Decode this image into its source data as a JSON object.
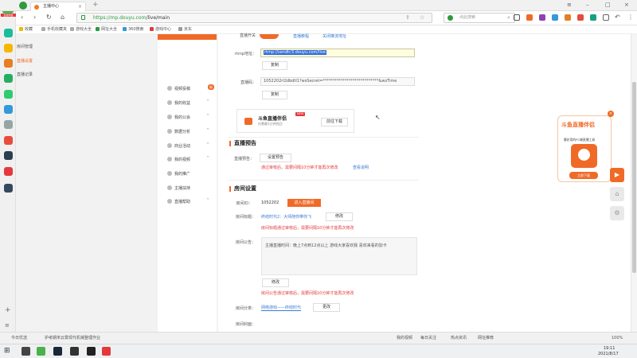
{
  "browser": {
    "tab_title": "主播中心",
    "tab_close": "×",
    "new_tab": "+",
    "url_host": "https://mp.douyu.com",
    "url_path": "/live/main",
    "search_placeholder": "点此搜索",
    "bookmarks": [
      "收藏",
      "手机收藏夹",
      "游戏大全",
      "网址大全",
      "360搜索",
      "游戏中心",
      "京东"
    ]
  },
  "left_bar_label": "百度网盘",
  "sidebar": {
    "sub_items": [
      "房间管理",
      "直播设置",
      "直播记录"
    ],
    "active_index": 1,
    "nav_items": [
      {
        "label": "视频投稿",
        "badge": "新"
      },
      {
        "label": "我的收益"
      },
      {
        "label": "我的公会"
      },
      {
        "label": "数据分析"
      },
      {
        "label": "商业活动"
      },
      {
        "label": "我的视频"
      },
      {
        "label": "我的推广"
      },
      {
        "label": "主播扶持"
      },
      {
        "label": "直播帮助"
      }
    ]
  },
  "top_section": {
    "label": "直播开关",
    "link1": "直播教程",
    "link2": "关闭推流地址"
  },
  "rtmp": {
    "label": "rtmp地址：",
    "value": "rtmp://sendtc3.douyu.com/live",
    "copy": "复制"
  },
  "code": {
    "label": "直播码：",
    "value": "1052202rl2dbdtl1?wsSecret=****************************&wsTime",
    "copy": "复制"
  },
  "promo": {
    "title": "斗鱼直播伴侣",
    "badge": "NEW",
    "subtitle": "仅需最1分钟找回",
    "download": "前往下载"
  },
  "preview": {
    "heading": "直播预告",
    "label": "直播预告：",
    "button": "设置预告",
    "note": "通过审核后，需要间隔10分钟才能再次修改",
    "link": "查看说明"
  },
  "room": {
    "heading": "房间设置",
    "id_label": "房间ID：",
    "id_value": "1052202",
    "enter_button": "进入直播间",
    "title_label": "房间标题：",
    "title_value": "终结时代2：大师随你带你飞",
    "title_edit": "修改",
    "title_note": "房间标题通过审核后，需要间隔10分钟才能再次修改",
    "notice_label": "房间公告：",
    "notice_value": "主播直播时间：晚上7点到12点以上 游戏大家喜欢我 喜欢来看的加卡",
    "notice_edit": "修改",
    "notice_note": "房间公告通过审核后，需要间隔10分钟才能再次修改",
    "category_label": "房间分类：",
    "category_value": "网络游戏——终结时代",
    "category_edit": "更改",
    "thumb_label": "房间封面："
  },
  "float_ad": {
    "title": "斗鱼直播伴侣",
    "subtitle": "最好用的PC端直播工具",
    "download": "立即下载",
    "close": "×"
  },
  "statusbar": {
    "left": [
      "今日优选",
      "护考期末云霄",
      "现代机械整理作业"
    ],
    "right": [
      "我的视频",
      "每日关注",
      "热点资讯",
      "网址推荐"
    ],
    "zoom": "100%"
  },
  "taskbar": {
    "time": "19:11",
    "date": "2021/8/17"
  },
  "colors": {
    "accent": "#f06a27",
    "link": "#3a7bd5",
    "warning": "#e4393c"
  }
}
